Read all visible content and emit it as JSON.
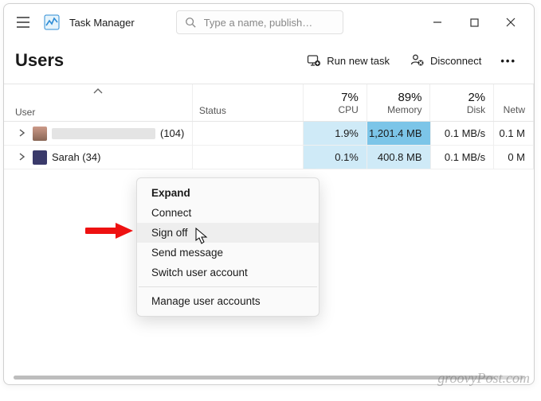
{
  "app": {
    "title": "Task Manager",
    "search_placeholder": "Type a name, publish…"
  },
  "toolbar": {
    "section": "Users",
    "run_new_task": "Run new task",
    "disconnect": "Disconnect",
    "more": "…"
  },
  "columns": {
    "user": "User",
    "status": "Status",
    "cpu_pct": "7%",
    "cpu_label": "CPU",
    "memory_pct": "89%",
    "memory_label": "Memory",
    "disk_pct": "2%",
    "disk_label": "Disk",
    "network_label": "Netw"
  },
  "rows": [
    {
      "user_suffix": "(104)",
      "redacted": true,
      "cpu": "1.9%",
      "memory": "1,201.4 MB",
      "disk": "0.1 MB/s",
      "network": "0.1 M"
    },
    {
      "user_label": "Sarah (34)",
      "cpu": "0.1%",
      "memory": "400.8 MB",
      "disk": "0.1 MB/s",
      "network": "0 M"
    }
  ],
  "context_menu": {
    "expand": "Expand",
    "connect": "Connect",
    "sign_off": "Sign off",
    "send_message": "Send message",
    "switch_user": "Switch user account",
    "manage_users": "Manage user accounts"
  },
  "watermark": "groovyPost.com"
}
